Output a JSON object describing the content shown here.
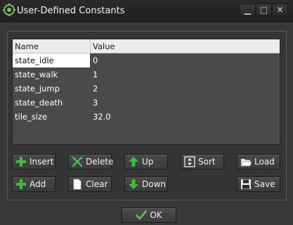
{
  "window": {
    "title": "User-Defined Constants",
    "controls": {
      "minimize": "▁",
      "maximize": "□",
      "close": "✕"
    }
  },
  "table": {
    "columns": [
      "Name",
      "Value"
    ],
    "rows": [
      {
        "name": "state_idle",
        "value": "0",
        "selected": true
      },
      {
        "name": "state_walk",
        "value": "1"
      },
      {
        "name": "state_jump",
        "value": "2"
      },
      {
        "name": "state_death",
        "value": "3"
      },
      {
        "name": "tile_size",
        "value": "32.0"
      }
    ]
  },
  "buttons": {
    "insert": {
      "label": "Insert",
      "icon": "green-plus-icon"
    },
    "delete": {
      "label": "Delete",
      "icon": "green-x-icon"
    },
    "up": {
      "label": "Up",
      "icon": "green-up-arrow-icon"
    },
    "sort": {
      "label": "Sort",
      "icon": "sort-icon"
    },
    "load": {
      "label": "Load",
      "icon": "open-folder-icon"
    },
    "add": {
      "label": "Add",
      "icon": "green-plus-icon"
    },
    "clear": {
      "label": "Clear",
      "icon": "blank-page-icon"
    },
    "down": {
      "label": "Down",
      "icon": "green-down-arrow-icon"
    },
    "save": {
      "label": "Save",
      "icon": "floppy-disk-icon"
    },
    "ok": {
      "label": "OK",
      "icon": "checkmark-icon"
    }
  },
  "colors": {
    "window_bg": "#383838",
    "titlebar_bg": "#202020",
    "list_bg": "#4a4a4a",
    "header_bg": "#ececec",
    "selection_bg": "#ffffff",
    "icon_green": "#3cbf3c"
  }
}
